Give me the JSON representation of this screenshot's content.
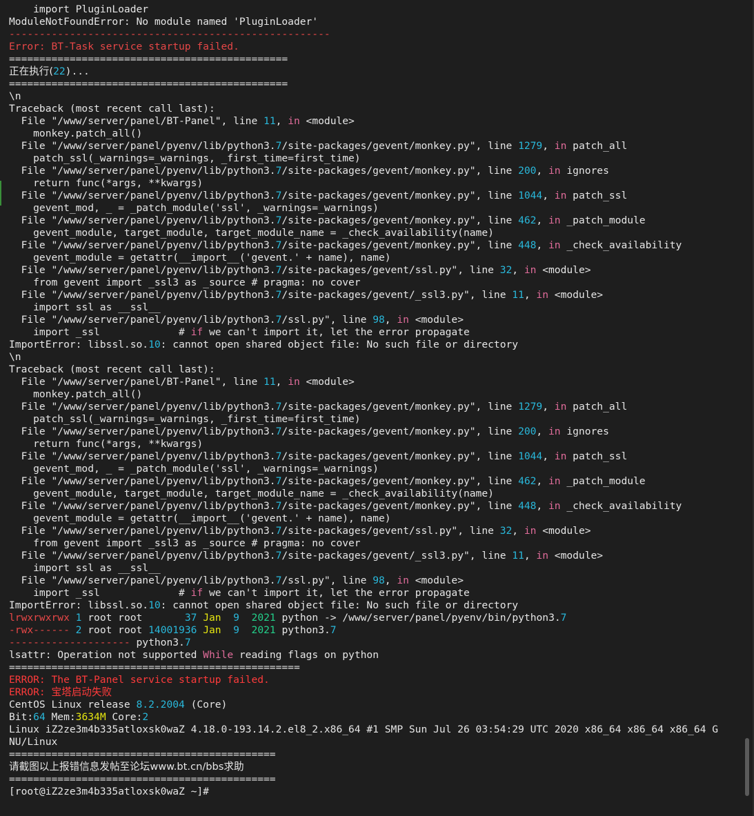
{
  "colors": {
    "default": "#e6e6e6",
    "cyan": "#29b8db",
    "red": "#e64747",
    "pink": "#e06c9a",
    "green": "#23d18b",
    "yellow": "#e5e510",
    "bright_red": "#ff3b3b",
    "background": "#1e1e1e"
  },
  "terminal": {
    "lines": [
      [
        [
          "    import PluginLoader",
          "default"
        ]
      ],
      [
        [
          "ModuleNotFoundError: No module named 'PluginLoader'",
          "default"
        ]
      ],
      [
        [
          "-----------------------------------------------------",
          "red"
        ]
      ],
      [
        [
          "Error: BT-Task service startup failed.",
          "red"
        ]
      ],
      [
        [
          "==============================================",
          "default"
        ]
      ],
      [
        [
          "正在执行(",
          "default",
          "cjk"
        ],
        [
          "22",
          "cyan"
        ],
        [
          ")...",
          "default"
        ]
      ],
      [
        [
          "==============================================",
          "default"
        ]
      ],
      [
        [
          "\\n",
          "default"
        ]
      ],
      [
        [
          "Traceback (most recent call last):",
          "default"
        ]
      ],
      [
        [
          "  File \"/www/server/panel/BT-Panel\", line ",
          "default"
        ],
        [
          "11",
          "cyan"
        ],
        [
          ", ",
          "default"
        ],
        [
          "in",
          "pink"
        ],
        [
          " <module>",
          "default"
        ]
      ],
      [
        [
          "    monkey.patch_all()",
          "default"
        ]
      ],
      [
        [
          "  File \"/www/server/panel/pyenv/lib/python3.",
          "default"
        ],
        [
          "7",
          "cyan"
        ],
        [
          "/site-packages/gevent/monkey.py\", line ",
          "default"
        ],
        [
          "1279",
          "cyan"
        ],
        [
          ", ",
          "default"
        ],
        [
          "in",
          "pink"
        ],
        [
          " patch_all",
          "default"
        ]
      ],
      [
        [
          "    patch_ssl(_warnings=_warnings, _first_time=first_time)",
          "default"
        ]
      ],
      [
        [
          "  File \"/www/server/panel/pyenv/lib/python3.",
          "default"
        ],
        [
          "7",
          "cyan"
        ],
        [
          "/site-packages/gevent/monkey.py\", line ",
          "default"
        ],
        [
          "200",
          "cyan"
        ],
        [
          ", ",
          "default"
        ],
        [
          "in",
          "pink"
        ],
        [
          " ignores",
          "default"
        ]
      ],
      [
        [
          "    return func(*args, **kwargs)",
          "default"
        ]
      ],
      [
        [
          "  File \"/www/server/panel/pyenv/lib/python3.",
          "default"
        ],
        [
          "7",
          "cyan"
        ],
        [
          "/site-packages/gevent/monkey.py\", line ",
          "default"
        ],
        [
          "1044",
          "cyan"
        ],
        [
          ", ",
          "default"
        ],
        [
          "in",
          "pink"
        ],
        [
          " patch_ssl",
          "default"
        ]
      ],
      [
        [
          "    gevent_mod, _ = _patch_module('ssl', _warnings=_warnings)",
          "default"
        ]
      ],
      [
        [
          "  File \"/www/server/panel/pyenv/lib/python3.",
          "default"
        ],
        [
          "7",
          "cyan"
        ],
        [
          "/site-packages/gevent/monkey.py\", line ",
          "default"
        ],
        [
          "462",
          "cyan"
        ],
        [
          ", ",
          "default"
        ],
        [
          "in",
          "pink"
        ],
        [
          " _patch_module",
          "default"
        ]
      ],
      [
        [
          "    gevent_module, target_module, target_module_name = _check_availability(name)",
          "default"
        ]
      ],
      [
        [
          "  File \"/www/server/panel/pyenv/lib/python3.",
          "default"
        ],
        [
          "7",
          "cyan"
        ],
        [
          "/site-packages/gevent/monkey.py\", line ",
          "default"
        ],
        [
          "448",
          "cyan"
        ],
        [
          ", ",
          "default"
        ],
        [
          "in",
          "pink"
        ],
        [
          " _check_availability",
          "default"
        ]
      ],
      [
        [
          "    gevent_module = getattr(__import__('gevent.' + name), name)",
          "default"
        ]
      ],
      [
        [
          "  File \"/www/server/panel/pyenv/lib/python3.",
          "default"
        ],
        [
          "7",
          "cyan"
        ],
        [
          "/site-packages/gevent/ssl.py\", line ",
          "default"
        ],
        [
          "32",
          "cyan"
        ],
        [
          ", ",
          "default"
        ],
        [
          "in",
          "pink"
        ],
        [
          " <module>",
          "default"
        ]
      ],
      [
        [
          "    from gevent import _ssl3 as _source # pragma: no cover",
          "default"
        ]
      ],
      [
        [
          "  File \"/www/server/panel/pyenv/lib/python3.",
          "default"
        ],
        [
          "7",
          "cyan"
        ],
        [
          "/site-packages/gevent/_ssl3.py\", line ",
          "default"
        ],
        [
          "11",
          "cyan"
        ],
        [
          ", ",
          "default"
        ],
        [
          "in",
          "pink"
        ],
        [
          " <module>",
          "default"
        ]
      ],
      [
        [
          "    import ssl as __ssl__",
          "default"
        ]
      ],
      [
        [
          "  File \"/www/server/panel/pyenv/lib/python3.",
          "default"
        ],
        [
          "7",
          "cyan"
        ],
        [
          "/ssl.py\", line ",
          "default"
        ],
        [
          "98",
          "cyan"
        ],
        [
          ", ",
          "default"
        ],
        [
          "in",
          "pink"
        ],
        [
          " <module>",
          "default"
        ]
      ],
      [
        [
          "    import _ssl             # ",
          "default"
        ],
        [
          "if",
          "pink"
        ],
        [
          " we can't import it, let the error propagate",
          "default"
        ]
      ],
      [
        [
          "ImportError: libssl.so.",
          "default"
        ],
        [
          "10",
          "cyan"
        ],
        [
          ": cannot open shared object file: No such file or directory",
          "default"
        ]
      ],
      [
        [
          "\\n",
          "default"
        ]
      ],
      [
        [
          "Traceback (most recent call last):",
          "default"
        ]
      ],
      [
        [
          "  File \"/www/server/panel/BT-Panel\", line ",
          "default"
        ],
        [
          "11",
          "cyan"
        ],
        [
          ", ",
          "default"
        ],
        [
          "in",
          "pink"
        ],
        [
          " <module>",
          "default"
        ]
      ],
      [
        [
          "    monkey.patch_all()",
          "default"
        ]
      ],
      [
        [
          "  File \"/www/server/panel/pyenv/lib/python3.",
          "default"
        ],
        [
          "7",
          "cyan"
        ],
        [
          "/site-packages/gevent/monkey.py\", line ",
          "default"
        ],
        [
          "1279",
          "cyan"
        ],
        [
          ", ",
          "default"
        ],
        [
          "in",
          "pink"
        ],
        [
          " patch_all",
          "default"
        ]
      ],
      [
        [
          "    patch_ssl(_warnings=_warnings, _first_time=first_time)",
          "default"
        ]
      ],
      [
        [
          "  File \"/www/server/panel/pyenv/lib/python3.",
          "default"
        ],
        [
          "7",
          "cyan"
        ],
        [
          "/site-packages/gevent/monkey.py\", line ",
          "default"
        ],
        [
          "200",
          "cyan"
        ],
        [
          ", ",
          "default"
        ],
        [
          "in",
          "pink"
        ],
        [
          " ignores",
          "default"
        ]
      ],
      [
        [
          "    return func(*args, **kwargs)",
          "default"
        ]
      ],
      [
        [
          "  File \"/www/server/panel/pyenv/lib/python3.",
          "default"
        ],
        [
          "7",
          "cyan"
        ],
        [
          "/site-packages/gevent/monkey.py\", line ",
          "default"
        ],
        [
          "1044",
          "cyan"
        ],
        [
          ", ",
          "default"
        ],
        [
          "in",
          "pink"
        ],
        [
          " patch_ssl",
          "default"
        ]
      ],
      [
        [
          "    gevent_mod, _ = _patch_module('ssl', _warnings=_warnings)",
          "default"
        ]
      ],
      [
        [
          "  File \"/www/server/panel/pyenv/lib/python3.",
          "default"
        ],
        [
          "7",
          "cyan"
        ],
        [
          "/site-packages/gevent/monkey.py\", line ",
          "default"
        ],
        [
          "462",
          "cyan"
        ],
        [
          ", ",
          "default"
        ],
        [
          "in",
          "pink"
        ],
        [
          " _patch_module",
          "default"
        ]
      ],
      [
        [
          "    gevent_module, target_module, target_module_name = _check_availability(name)",
          "default"
        ]
      ],
      [
        [
          "  File \"/www/server/panel/pyenv/lib/python3.",
          "default"
        ],
        [
          "7",
          "cyan"
        ],
        [
          "/site-packages/gevent/monkey.py\", line ",
          "default"
        ],
        [
          "448",
          "cyan"
        ],
        [
          ", ",
          "default"
        ],
        [
          "in",
          "pink"
        ],
        [
          " _check_availability",
          "default"
        ]
      ],
      [
        [
          "    gevent_module = getattr(__import__('gevent.' + name), name)",
          "default"
        ]
      ],
      [
        [
          "  File \"/www/server/panel/pyenv/lib/python3.",
          "default"
        ],
        [
          "7",
          "cyan"
        ],
        [
          "/site-packages/gevent/ssl.py\", line ",
          "default"
        ],
        [
          "32",
          "cyan"
        ],
        [
          ", ",
          "default"
        ],
        [
          "in",
          "pink"
        ],
        [
          " <module>",
          "default"
        ]
      ],
      [
        [
          "    from gevent import _ssl3 as _source # pragma: no cover",
          "default"
        ]
      ],
      [
        [
          "  File \"/www/server/panel/pyenv/lib/python3.",
          "default"
        ],
        [
          "7",
          "cyan"
        ],
        [
          "/site-packages/gevent/_ssl3.py\", line ",
          "default"
        ],
        [
          "11",
          "cyan"
        ],
        [
          ", ",
          "default"
        ],
        [
          "in",
          "pink"
        ],
        [
          " <module>",
          "default"
        ]
      ],
      [
        [
          "    import ssl as __ssl__",
          "default"
        ]
      ],
      [
        [
          "  File \"/www/server/panel/pyenv/lib/python3.",
          "default"
        ],
        [
          "7",
          "cyan"
        ],
        [
          "/ssl.py\", line ",
          "default"
        ],
        [
          "98",
          "cyan"
        ],
        [
          ", ",
          "default"
        ],
        [
          "in",
          "pink"
        ],
        [
          " <module>",
          "default"
        ]
      ],
      [
        [
          "    import _ssl             # ",
          "default"
        ],
        [
          "if",
          "pink"
        ],
        [
          " we can't import it, let the error propagate",
          "default"
        ]
      ],
      [
        [
          "ImportError: libssl.so.",
          "default"
        ],
        [
          "10",
          "cyan"
        ],
        [
          ": cannot open shared object file: No such file or directory",
          "default"
        ]
      ],
      [
        [
          "lrwxrwxrwx",
          "red"
        ],
        [
          " ",
          "default"
        ],
        [
          "1",
          "cyan"
        ],
        [
          " root root       ",
          "default"
        ],
        [
          "37",
          "cyan"
        ],
        [
          " ",
          "default"
        ],
        [
          "Jan",
          "yellow"
        ],
        [
          "  ",
          "default"
        ],
        [
          "9",
          "cyan"
        ],
        [
          "  ",
          "default"
        ],
        [
          "2021",
          "green"
        ],
        [
          " python -> /www/server/panel/pyenv/bin/python3.",
          "default"
        ],
        [
          "7",
          "cyan"
        ]
      ],
      [
        [
          "-rwx------",
          "red"
        ],
        [
          " ",
          "default"
        ],
        [
          "2",
          "cyan"
        ],
        [
          " root root ",
          "default"
        ],
        [
          "14001936",
          "cyan"
        ],
        [
          " ",
          "default"
        ],
        [
          "Jan",
          "yellow"
        ],
        [
          "  ",
          "default"
        ],
        [
          "9",
          "cyan"
        ],
        [
          "  ",
          "default"
        ],
        [
          "2021",
          "green"
        ],
        [
          " python3.",
          "default"
        ],
        [
          "7",
          "cyan"
        ]
      ],
      [
        [
          "--------------------",
          "red"
        ],
        [
          " python3.",
          "default"
        ],
        [
          "7",
          "cyan"
        ]
      ],
      [
        [
          "lsattr: Operation not supported ",
          "default"
        ],
        [
          "While",
          "pink"
        ],
        [
          " reading flags on python",
          "default"
        ]
      ],
      [
        [
          "================================================",
          "default"
        ]
      ],
      [
        [
          "ERROR: The BT-Panel service startup failed.",
          "bright_red"
        ]
      ],
      [
        [
          "ERROR: ",
          "bright_red"
        ],
        [
          "宝塔启动失败",
          "bright_red",
          "cjk"
        ]
      ],
      [
        [
          "CentOS Linux release ",
          "default"
        ],
        [
          "8.2.2004",
          "cyan"
        ],
        [
          " (Core)",
          "default"
        ]
      ],
      [
        [
          "Bit:",
          "default"
        ],
        [
          "64",
          "cyan"
        ],
        [
          " Mem:",
          "default"
        ],
        [
          "3634M",
          "yellow"
        ],
        [
          " Core:",
          "default"
        ],
        [
          "2",
          "cyan"
        ]
      ],
      [
        [
          "Linux iZ2ze3m4b335atloxsk0waZ 4.18.0-193.14.2.el8_2.x86_64 #1 SMP Sun Jul 26 03:54:29 UTC 2020 x86_64 x86_64 x86_64 G",
          "default"
        ]
      ],
      [
        [
          "NU/Linux",
          "default"
        ]
      ],
      [
        [
          "============================================",
          "default"
        ]
      ],
      [
        [
          "请截图以上报错信息发帖至论坛www.bt.cn/bbs求助",
          "default",
          "cjk"
        ]
      ],
      [
        [
          "============================================",
          "default"
        ]
      ],
      [
        [
          "[root@iZ2ze3m4b335atloxsk0waZ ~]#",
          "default"
        ]
      ]
    ]
  }
}
